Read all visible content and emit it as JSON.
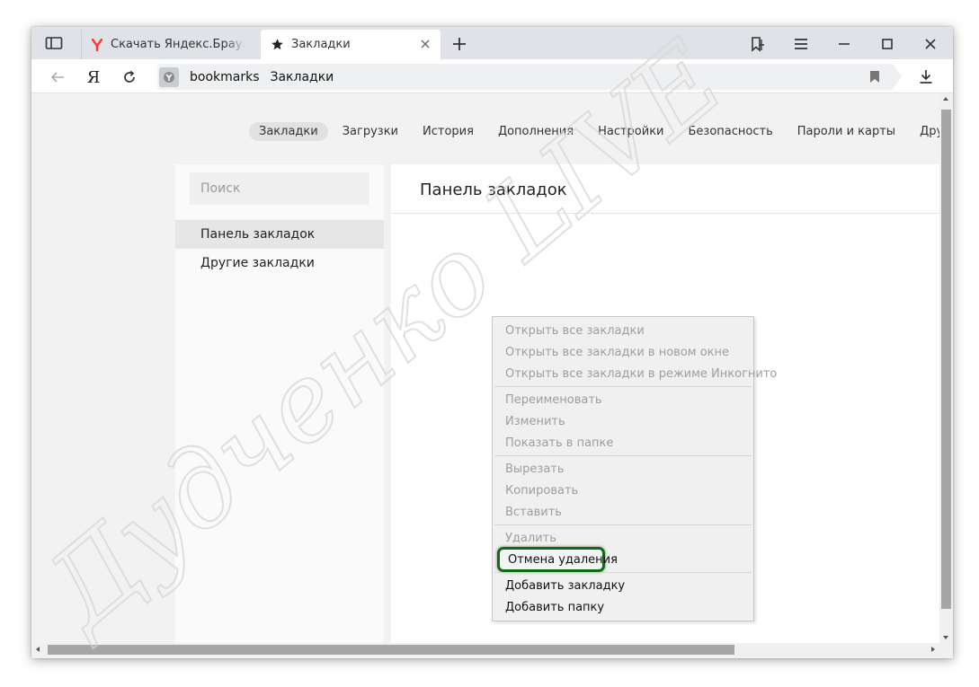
{
  "tabs": [
    {
      "title": "Скачать Яндекс.Браузер для компьютера",
      "favicon": "yandex-y-icon",
      "active": false
    },
    {
      "title": "Закладки",
      "favicon": "star-icon",
      "active": true
    }
  ],
  "address_bar": {
    "host": "bookmarks",
    "page_title": "Закладки"
  },
  "toolbar": {
    "yandex_logo": "Я"
  },
  "nav_links": [
    {
      "label": "Закладки",
      "active": true
    },
    {
      "label": "Загрузки",
      "active": false
    },
    {
      "label": "История",
      "active": false
    },
    {
      "label": "Дополнения",
      "active": false
    },
    {
      "label": "Настройки",
      "active": false
    },
    {
      "label": "Безопасность",
      "active": false
    },
    {
      "label": "Пароли и карты",
      "active": false
    },
    {
      "label": "Другие устройства",
      "active": false
    }
  ],
  "sidebar": {
    "search_placeholder": "Поиск",
    "folders": [
      {
        "label": "Панель закладок",
        "selected": true
      },
      {
        "label": "Другие закладки",
        "selected": false
      }
    ]
  },
  "content": {
    "title": "Панель закладок"
  },
  "context_menu": {
    "groups": [
      [
        {
          "label": "Открыть все закладки",
          "enabled": false
        },
        {
          "label": "Открыть все закладки в новом окне",
          "enabled": false
        },
        {
          "label": "Открыть все закладки в режиме Инкогнито",
          "enabled": false
        }
      ],
      [
        {
          "label": "Переименовать",
          "enabled": false
        },
        {
          "label": "Изменить",
          "enabled": false
        },
        {
          "label": "Показать в папке",
          "enabled": false
        }
      ],
      [
        {
          "label": "Вырезать",
          "enabled": false
        },
        {
          "label": "Копировать",
          "enabled": false
        },
        {
          "label": "Вставить",
          "enabled": false
        }
      ],
      [
        {
          "label": "Удалить",
          "enabled": false
        },
        {
          "label": "Отмена удаления",
          "enabled": true,
          "highlighted": true
        }
      ],
      [
        {
          "label": "Добавить закладку",
          "enabled": true
        },
        {
          "label": "Добавить папку",
          "enabled": true
        }
      ]
    ]
  },
  "watermark": {
    "text": "Дудченко LIVE"
  },
  "colors": {
    "highlight_border": "#0f6b15",
    "yandex_red": "#f33"
  }
}
